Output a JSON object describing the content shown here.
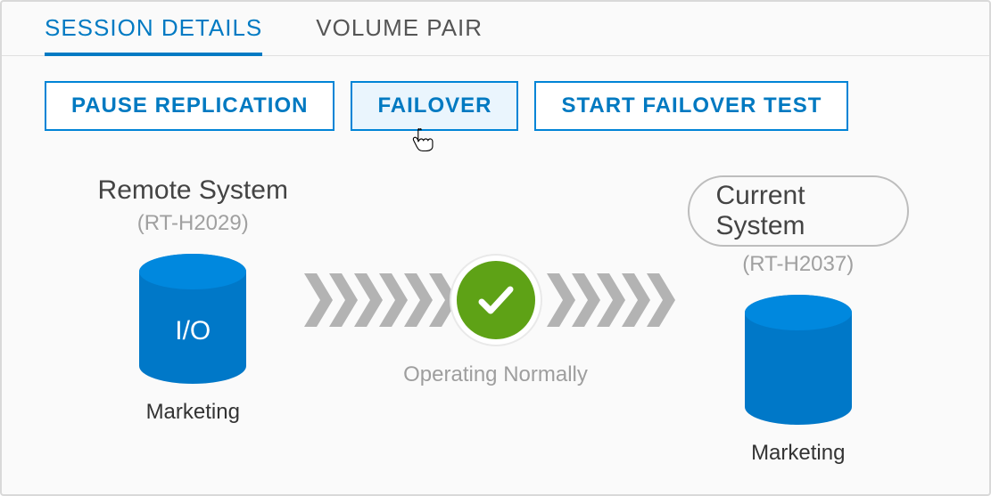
{
  "tabs": {
    "session_details": "SESSION DETAILS",
    "volume_pair": "VOLUME PAIR"
  },
  "actions": {
    "pause": "PAUSE REPLICATION",
    "failover": "FAILOVER",
    "start_test": "START FAILOVER TEST"
  },
  "remote": {
    "title": "Remote System",
    "id": "(RT-H2029)",
    "io_label": "I/O",
    "volume": "Marketing"
  },
  "current": {
    "title": "Current System",
    "id": "(RT-H2037)",
    "volume": "Marketing"
  },
  "status": {
    "text": "Operating Normally"
  },
  "colors": {
    "accent": "#007ac3",
    "cylinder": "#0078c8",
    "ok": "#5ea216",
    "chevron": "#b3b3b3"
  }
}
